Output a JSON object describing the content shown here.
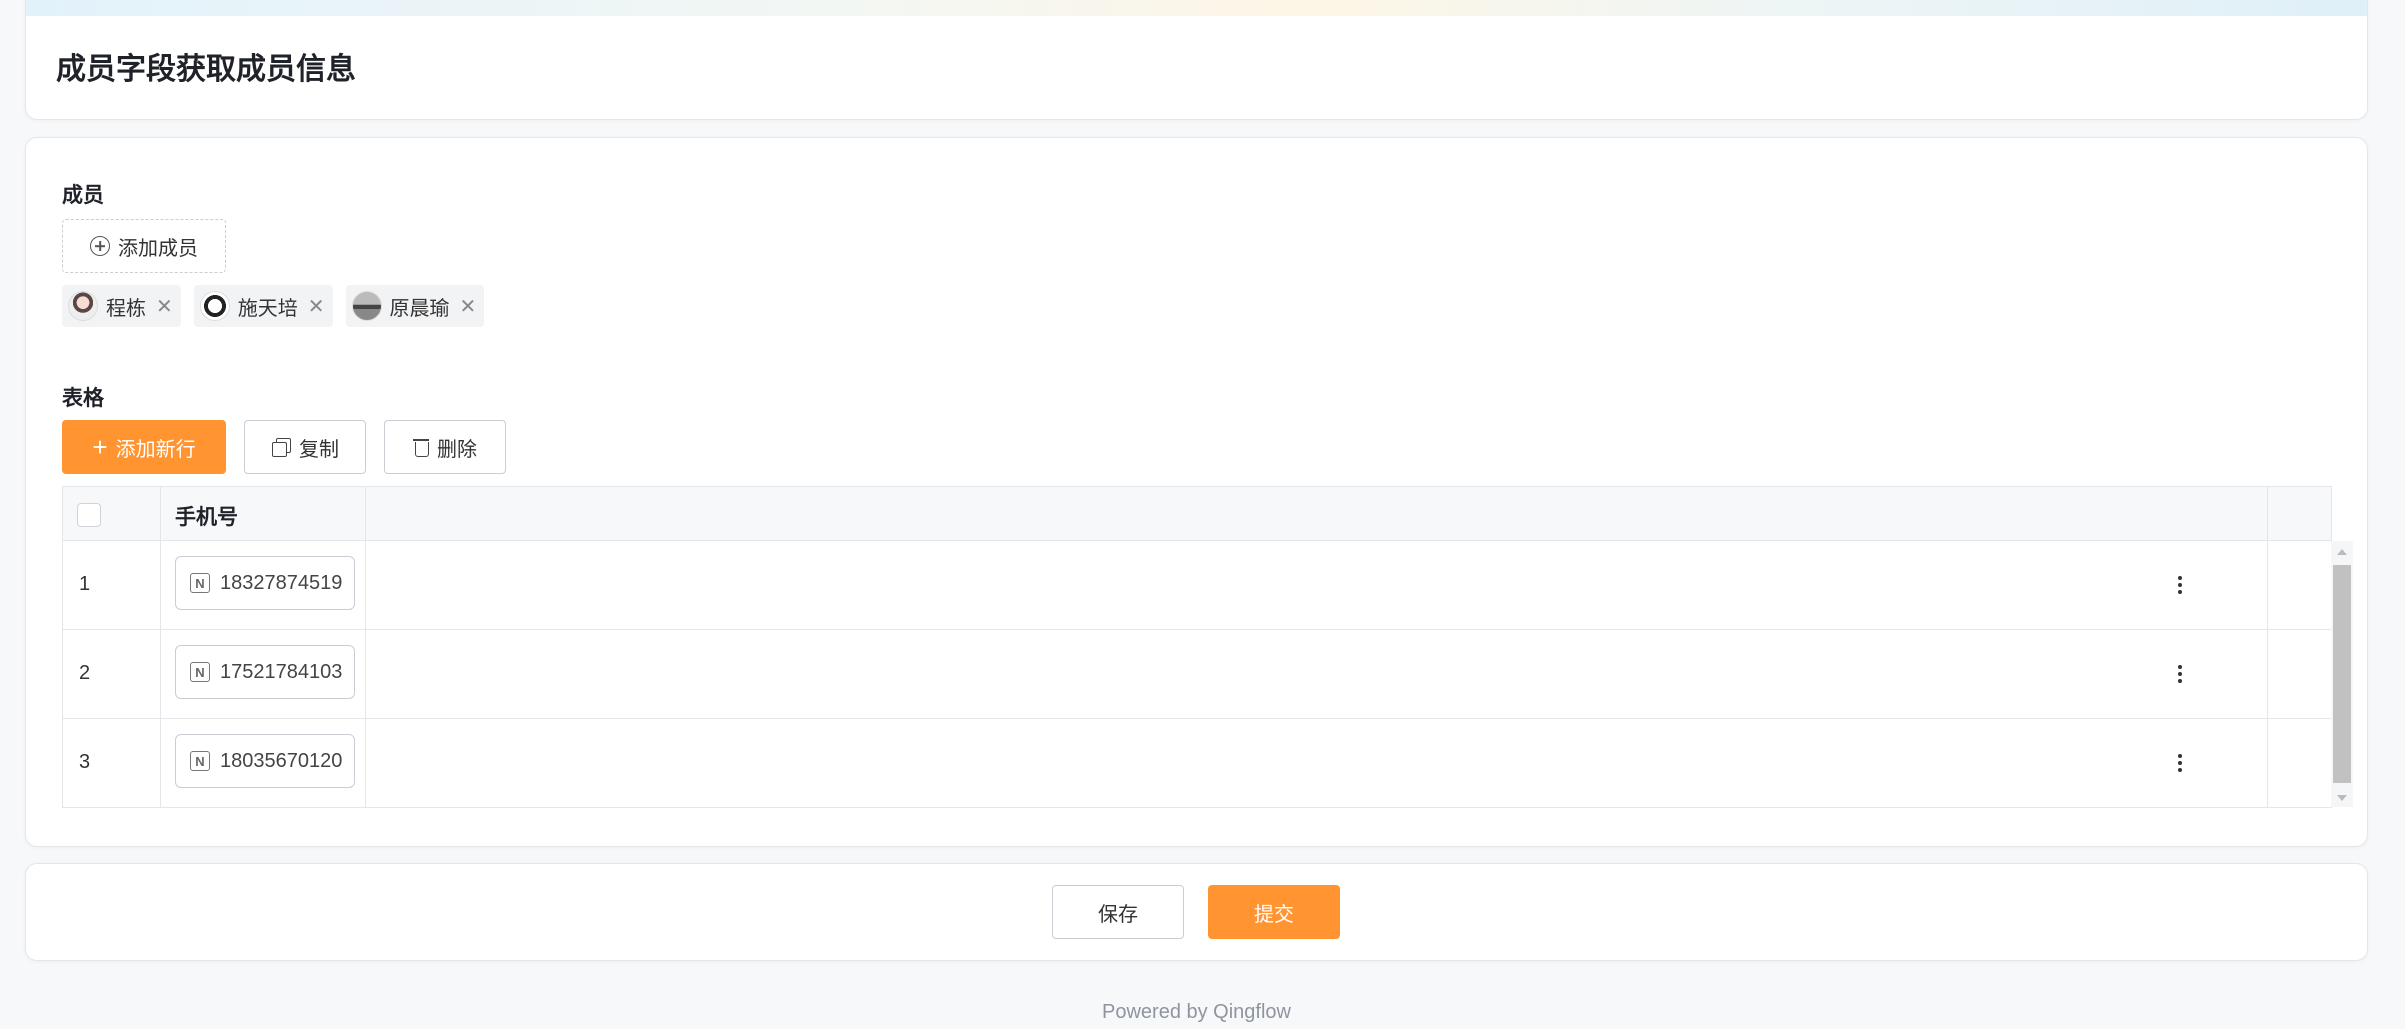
{
  "header": {
    "title": "成员字段获取成员信息"
  },
  "members": {
    "label": "成员",
    "add_button": "添加成员",
    "tags": [
      {
        "name": "程栋",
        "avatar": "avatar-1"
      },
      {
        "name": "施天培",
        "avatar": "avatar-2"
      },
      {
        "name": "原晨瑜",
        "avatar": "avatar-3"
      }
    ]
  },
  "table_field": {
    "label": "表格",
    "buttons": {
      "add_row": "添加新行",
      "copy": "复制",
      "delete": "删除"
    },
    "columns": [
      "手机号"
    ],
    "rows": [
      {
        "num": "1",
        "phone": "18327874519"
      },
      {
        "num": "2",
        "phone": "17521784103"
      },
      {
        "num": "3",
        "phone": "18035670120"
      }
    ]
  },
  "footer": {
    "save": "保存",
    "submit": "提交",
    "powered_by": "Powered by Qingflow"
  },
  "colors": {
    "accent": "#ff9431",
    "border": "#c9cdd4",
    "background": "#f7f8fa"
  }
}
